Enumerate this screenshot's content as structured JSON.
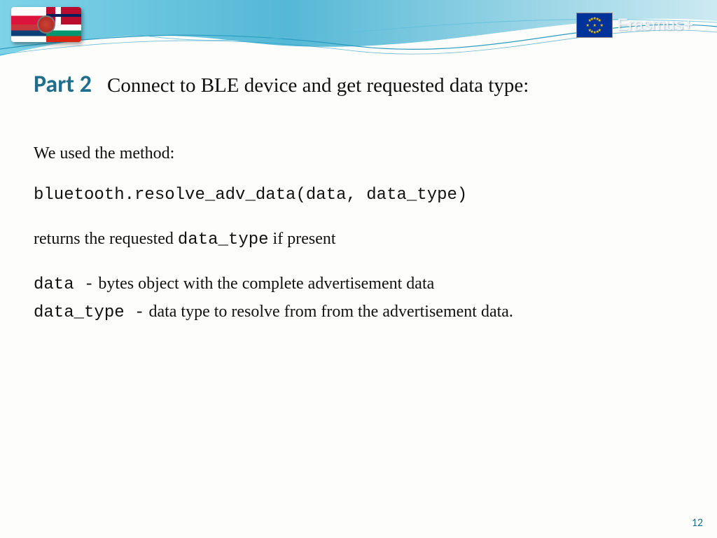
{
  "header": {
    "program_name": "Erasmus+"
  },
  "slide": {
    "part_label": "Part 2",
    "title": "Connect to BLE device and get requested data type:",
    "intro": "We used the method:",
    "method_signature": "bluetooth.resolve_adv_data(data, data_type)",
    "returns_prefix": "returns the requested ",
    "returns_code": "data_type",
    "returns_suffix": "  if present",
    "param1_code": "data -",
    "param1_desc": "  bytes object with the complete advertisement data",
    "param2_code": "data_type -",
    "param2_desc": "  data type to resolve from from the advertisement data."
  },
  "page_number": "12"
}
